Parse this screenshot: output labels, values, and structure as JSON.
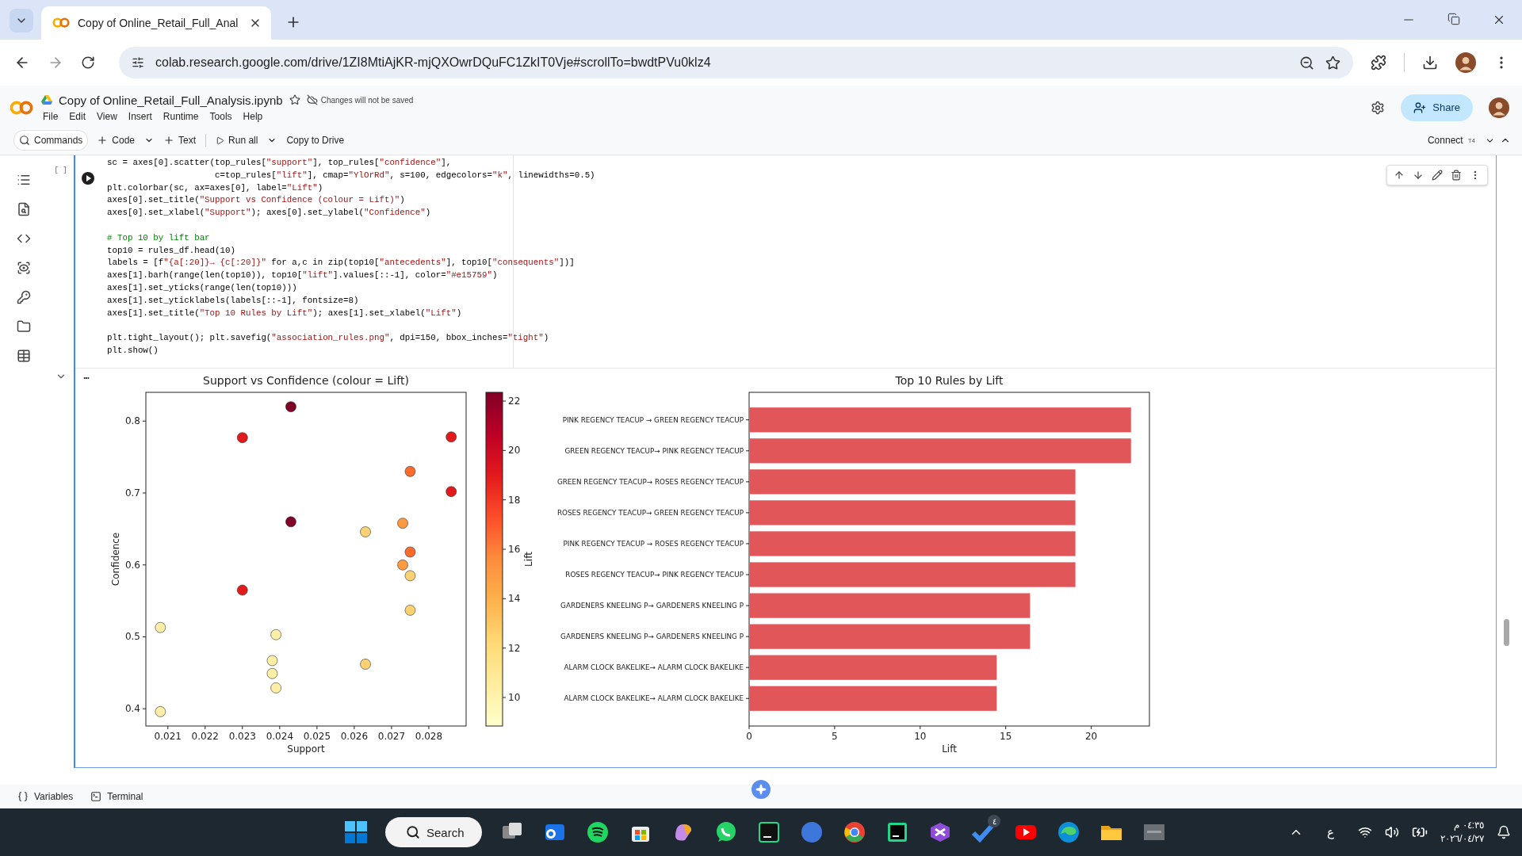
{
  "browser": {
    "tab_title": "Copy of Online_Retail_Full_Anal",
    "url": "colab.research.google.com/drive/1ZI8MtiAjKR-mjQXOwrDQuFC1ZkIT0Vje#scrollTo=bwdtPVu0klz4"
  },
  "header": {
    "title": "Copy of Online_Retail_Full_Analysis.ipynb",
    "save_status": "Changes will not be saved",
    "menu": [
      "File",
      "Edit",
      "View",
      "Insert",
      "Runtime",
      "Tools",
      "Help"
    ],
    "share": "Share"
  },
  "toolbar": {
    "items": [
      {
        "kind": "search",
        "label": "Commands",
        "caret": false
      },
      {
        "kind": "add",
        "label": "Code",
        "caret": true
      },
      {
        "kind": "add",
        "label": "Text",
        "caret": false
      },
      {
        "kind": "run",
        "label": "Run all",
        "caret": true
      },
      {
        "kind": "plain",
        "label": "Copy to Drive",
        "caret": false
      }
    ],
    "connect": {
      "label": "Connect",
      "runtime": "T4"
    }
  },
  "cell": {
    "execution_count": "[ ]",
    "output_menu": "...",
    "code_blocks": [
      [
        "sc = axes[0].scatter(top_rules[\"support\"], top_rules[\"confidence\"],",
        "                     c=top_rules[\"lift\"], cmap=\"YlOrRd\", s=100, edgecolors=\"k\", linewidths=0.5)",
        "plt.colorbar(sc, ax=axes[0], label=\"Lift\")",
        "axes[0].set_title(\"Support vs Confidence (colour = Lift)\")",
        "axes[0].set_xlabel(\"Support\"); axes[0].set_ylabel(\"Confidence\")"
      ],
      [
        "# Top 10 by lift bar",
        "top10 = rules_df.head(10)",
        "labels = [f\"{a[:20]}→ {c[:20]}\" for a,c in zip(top10[\"antecedents\"], top10[\"consequents\"])]",
        "axes[1].barh(range(len(top10)), top10[\"lift\"].values[::-1], color=\"#e15759\")",
        "axes[1].set_yticks(range(len(top10)))",
        "axes[1].set_yticklabels(labels[::-1], fontsize=8)",
        "axes[1].set_title(\"Top 10 Rules by Lift\"); axes[1].set_xlabel(\"Lift\")"
      ],
      [
        "plt.tight_layout(); plt.savefig(\"association_rules.png\", dpi=150, bbox_inches=\"tight\")",
        "plt.show()"
      ]
    ],
    "charts": [
      {
        "colorbar": {
          "label": "Lift",
          "ticks": [
            "22",
            "20",
            "18",
            "16",
            "14",
            "12",
            "10"
          ]
        },
        "points": [
          {
            "color": "#800026"
          },
          {
            "color": "#800026"
          },
          {
            "color": "#e31a1c"
          },
          {
            "color": "#e31a1c"
          },
          {
            "color": "#e31a1c"
          },
          {
            "color": "#e31a1c"
          },
          {
            "color": "#fc6a2c"
          },
          {
            "color": "#fc6a2c"
          },
          {
            "color": "#fd9a40"
          },
          {
            "color": "#fd9a40"
          },
          {
            "color": "#fed272"
          },
          {
            "color": "#fed272"
          },
          {
            "color": "#fed272"
          },
          {
            "color": "#fed272"
          },
          {
            "color": "#ffefa6"
          },
          {
            "color": "#ffefa6"
          },
          {
            "color": "#ffefa6"
          },
          {
            "color": "#ffefa6"
          },
          {
            "color": "#ffefa6"
          },
          {
            "color": "#ffefa6"
          }
        ],
        "chart_data": {
          "type": "scatter",
          "title": "Support vs Confidence (colour = Lift)",
          "xlabel": "Support",
          "xlim": [
            0.02041,
            0.029
          ],
          "ylim": [
            0.376,
            0.84
          ],
          "xticks": [
            0.021,
            0.022,
            0.023,
            0.024,
            0.025,
            0.026,
            0.027,
            0.028
          ],
          "yticks": [
            0.4,
            0.5,
            0.6,
            0.7,
            0.8
          ],
          "x": [
            0.0243,
            0.0243,
            0.023,
            0.0286,
            0.0286,
            0.023,
            0.0275,
            0.0275,
            0.0273,
            0.0273,
            0.0263,
            0.0275,
            0.0275,
            0.0263,
            0.0208,
            0.0239,
            0.0238,
            0.0238,
            0.0239,
            0.0208
          ],
          "series": [
            {
              "name": "Confidence",
              "values": [
                0.82,
                0.66,
                0.777,
                0.778,
                0.702,
                0.565,
                0.73,
                0.618,
                0.658,
                0.6,
                0.646,
                0.585,
                0.537,
                0.462,
                0.513,
                0.503,
                0.467,
                0.449,
                0.429,
                0.396
              ]
            }
          ]
        }
      },
      {
        "chart_data": {
          "type": "bar",
          "orientation": "horizontal",
          "title": "Top 10 Rules by Lift",
          "xlim": [
            0,
            23.4
          ],
          "xticks": [
            0,
            5,
            10,
            15,
            20
          ],
          "categories": [
            "PINK REGENCY TEACUP → GREEN REGENCY TEACUP",
            "GREEN REGENCY TEACUP→ PINK REGENCY TEACUP",
            "GREEN REGENCY TEACUP→ ROSES REGENCY TEACUP",
            "ROSES REGENCY TEACUP→ GREEN REGENCY TEACUP",
            "PINK REGENCY TEACUP → ROSES REGENCY TEACUP",
            "ROSES REGENCY TEACUP→ PINK REGENCY TEACUP",
            "GARDENERS KNEELING P→ GARDENERS KNEELING P",
            "GARDENERS KNEELING P→ GARDENERS KNEELING P",
            "ALARM CLOCK BAKELIKE→ ALARM CLOCK BAKELIKE",
            "ALARM CLOCK BAKELIKE→ ALARM CLOCK BAKELIKE"
          ],
          "series": [
            {
              "name": "Lift",
              "color": "#e15759",
              "values": [
                22.3,
                22.3,
                19.05,
                19.05,
                19.05,
                19.05,
                16.4,
                16.4,
                14.45,
                14.45
              ]
            }
          ]
        }
      }
    ]
  },
  "bottom_bar": [
    {
      "kind": "variables",
      "label": "Variables"
    },
    {
      "kind": "terminal",
      "label": "Terminal"
    }
  ],
  "taskbar": {
    "search": "Search",
    "badge": "٤",
    "language": "ع",
    "time": "٠٤:٣٥ م",
    "date": "٢٠٢٦/٠٤/٢٧"
  }
}
